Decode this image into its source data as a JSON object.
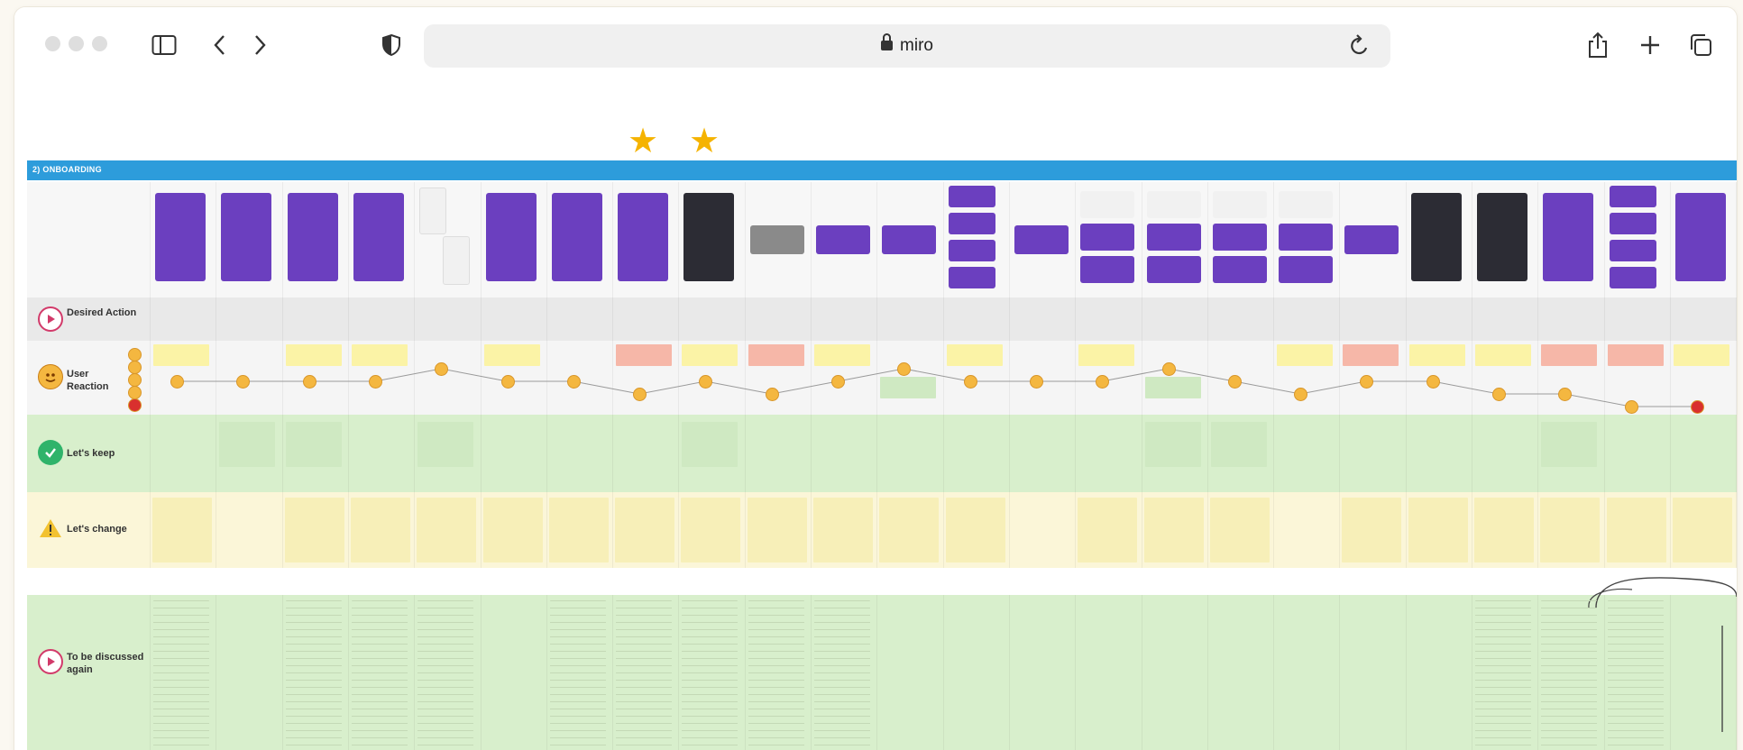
{
  "browser": {
    "url": "miro",
    "icons": [
      "sidebar-icon",
      "back-icon",
      "forward-icon",
      "shield-icon",
      "lock-icon",
      "reload-icon",
      "share-icon",
      "new-tab-icon",
      "tabs-icon"
    ]
  },
  "board": {
    "section_title": "2) ONBOARDING",
    "rows": {
      "desired_action": "Desired Action",
      "user_reaction": "User Reaction",
      "lets_keep": "Let's keep",
      "lets_change": "Let's change",
      "discuss": "To be discussed again"
    },
    "colors": {
      "banner": "#2d9cdb",
      "keep": "#d8efcc",
      "change": "#fbf6d8",
      "screen_purple": "#6b3fbf",
      "star": "#f5b301"
    }
  }
}
